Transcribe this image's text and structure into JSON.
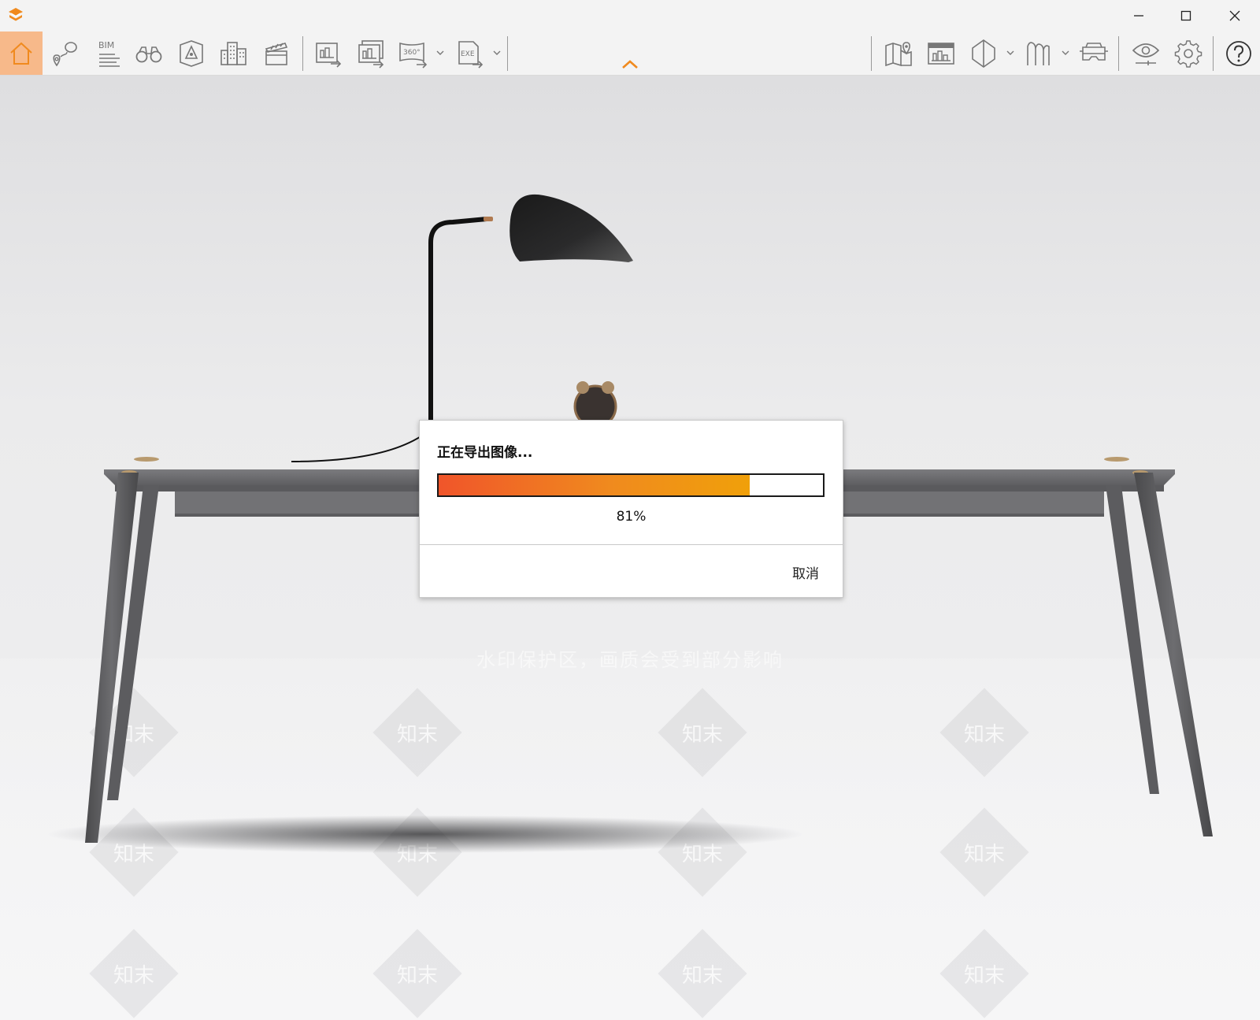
{
  "titlebar": {
    "logo_icon": "app-logo-icon",
    "controls": [
      "minimize-icon",
      "maximize-icon",
      "close-icon"
    ]
  },
  "toolbar": {
    "accent_color": "#f7b98a",
    "left_tools": [
      {
        "name": "home",
        "icon": "home-icon",
        "active": true
      },
      {
        "name": "location",
        "icon": "location-pin-icon"
      },
      {
        "name": "bim",
        "icon": "bim-icon",
        "label": "BIM"
      },
      {
        "name": "binoculars",
        "icon": "binoculars-icon"
      },
      {
        "name": "camera-view",
        "icon": "camera-view-icon"
      },
      {
        "name": "buildings",
        "icon": "buildings-icon"
      },
      {
        "name": "clapperboard",
        "icon": "clapperboard-icon"
      }
    ],
    "export_tools": [
      {
        "name": "export-image",
        "icon": "export-image-icon"
      },
      {
        "name": "export-batch",
        "icon": "export-batch-icon"
      },
      {
        "name": "export-360",
        "icon": "export-360-icon",
        "label": "360°"
      },
      {
        "name": "export-exe",
        "icon": "export-exe-icon",
        "label": "EXE"
      }
    ],
    "right_tools": [
      {
        "name": "map",
        "icon": "map-icon"
      },
      {
        "name": "panel",
        "icon": "panel-icon"
      },
      {
        "name": "section",
        "icon": "section-icon"
      },
      {
        "name": "material",
        "icon": "material-icon"
      },
      {
        "name": "vr",
        "icon": "vr-headset-icon"
      },
      {
        "name": "visibility",
        "icon": "eye-icon"
      },
      {
        "name": "settings",
        "icon": "gear-icon"
      },
      {
        "name": "help",
        "icon": "help-icon"
      }
    ]
  },
  "viewport": {
    "watermark_line": "水印保护区，画质会受到部分影响",
    "watermark_tile_text": "知末"
  },
  "dialog": {
    "title": "正在导出图像...",
    "progress": 81,
    "progress_text": "81%",
    "cancel_label": "取消"
  }
}
